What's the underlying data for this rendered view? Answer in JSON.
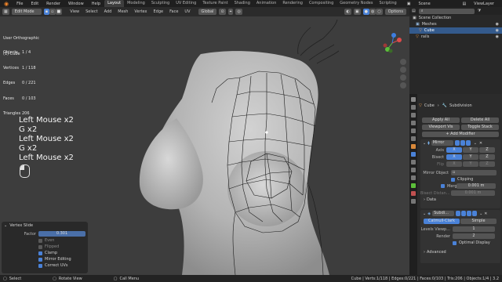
{
  "menubar": {
    "menus": [
      "File",
      "Edit",
      "Render",
      "Window",
      "Help"
    ],
    "workspaces": [
      "Layout",
      "Modeling",
      "Sculpting",
      "UV Editing",
      "Texture Paint",
      "Shading",
      "Animation",
      "Rendering",
      "Compositing",
      "Geometry Nodes",
      "Scripting"
    ],
    "active_workspace": "Layout",
    "scene": "Scene",
    "view_layer": "ViewLayer"
  },
  "viewport_header": {
    "mode": "Edit Mode",
    "menus": [
      "View",
      "Select",
      "Add",
      "Mesh",
      "Vertex",
      "Edge",
      "Face",
      "UV"
    ],
    "transform_orientation": "Global",
    "options_label": "Options"
  },
  "overlay": {
    "view_name": "User Orthographic",
    "object_name": "(1) Cube",
    "stats": [
      {
        "label": "Objects",
        "value": "1 / 4"
      },
      {
        "label": "Vertices",
        "value": "1 / 118"
      },
      {
        "label": "Edges",
        "value": "0 / 221"
      },
      {
        "label": "Faces",
        "value": "0 / 103"
      },
      {
        "label": "Triangles",
        "value": "206"
      }
    ]
  },
  "key_log": [
    "Left Mouse x2",
    "G x2",
    "Left Mouse x2",
    "G x2",
    "Left Mouse x2"
  ],
  "navigation_gizmo": {
    "x_color": "#e04a4a",
    "y_color": "#5cbf3a",
    "z_color": "#3d7de0"
  },
  "redo_panel": {
    "title": "Vertex Slide",
    "factor_label": "Factor",
    "factor_value": "0.301",
    "options": [
      {
        "label": "Even",
        "checked": false
      },
      {
        "label": "Flipped",
        "checked": false
      },
      {
        "label": "Clamp",
        "checked": true
      },
      {
        "label": "Mirror Editing",
        "checked": true
      },
      {
        "label": "Correct UVs",
        "checked": true
      }
    ]
  },
  "status_bar": {
    "left_items": [
      "Select",
      "Rotate View",
      "Call Menu"
    ],
    "right_text": "Cube | Verts:1/118 | Edges:0/221 | Faces:0/103 | Tris:206 | Objects:1/4 | 3.2"
  },
  "outliner": {
    "title": "Scene Collection",
    "items": [
      {
        "name": "Scene Collection",
        "selected": false
      },
      {
        "name": "Meshes",
        "selected": false
      },
      {
        "name": "Cube",
        "selected": true
      },
      {
        "name": "rails",
        "selected": false
      }
    ]
  },
  "properties": {
    "breadcrumb_object": "Cube",
    "breadcrumb_modifier": "Subdivision",
    "apply_all": "Apply All",
    "delete_all": "Delete All",
    "viewport_vis": "Viewport Vis",
    "toggle_stack": "Toggle Stack",
    "add_modifier": "Add Modifier",
    "mirror": {
      "name": "Mirror",
      "axis_label": "Axis",
      "bisect_label": "Bisect",
      "flip_label": "Flip",
      "axes": [
        "X",
        "Y",
        "Z"
      ],
      "mirror_object_label": "Mirror Object",
      "clipping_label": "Clipping",
      "merge_label": "Merge",
      "merge_value": "0.001 m",
      "bisect_distance_label": "Bisect Distan...",
      "bisect_distance_value": "0.001 m",
      "data_label": "Data"
    },
    "subdivision": {
      "name": "Subdi...",
      "catmull": "Catmull-Clark",
      "simple": "Simple",
      "levels_label": "Levels Viewp...",
      "levels_value": "1",
      "render_label": "Render",
      "render_value": "2",
      "optimal_label": "Optimal Display",
      "advanced_label": "Advanced"
    }
  }
}
